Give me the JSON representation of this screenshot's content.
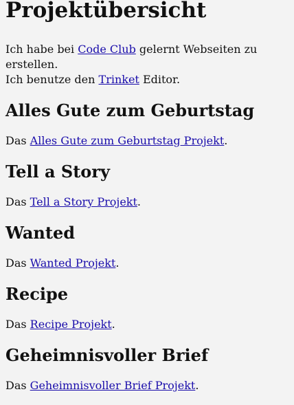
{
  "page": {
    "title": "Projektübersicht",
    "intro": {
      "line1_before": "Ich habe bei ",
      "line1_link": "Code Club",
      "line1_after": " gelernt Webseiten zu erstellen.",
      "line2_before": "Ich benutze den ",
      "line2_link": "Trinket",
      "line2_after": " Editor."
    },
    "sections": [
      {
        "heading": "Alles Gute zum Geburtstag",
        "prefix": "Das ",
        "link": "Alles Gute zum Geburtstag Projekt",
        "suffix": "."
      },
      {
        "heading": "Tell a Story",
        "prefix": "Das ",
        "link": "Tell a Story Projekt",
        "suffix": "."
      },
      {
        "heading": "Wanted",
        "prefix": "Das ",
        "link": "Wanted Projekt",
        "suffix": "."
      },
      {
        "heading": "Recipe",
        "prefix": "Das ",
        "link": "Recipe Projekt",
        "suffix": "."
      },
      {
        "heading": "Geheimnisvoller Brief",
        "prefix": "Das ",
        "link": "Geheimnisvoller Brief Projekt",
        "suffix": "."
      }
    ]
  }
}
